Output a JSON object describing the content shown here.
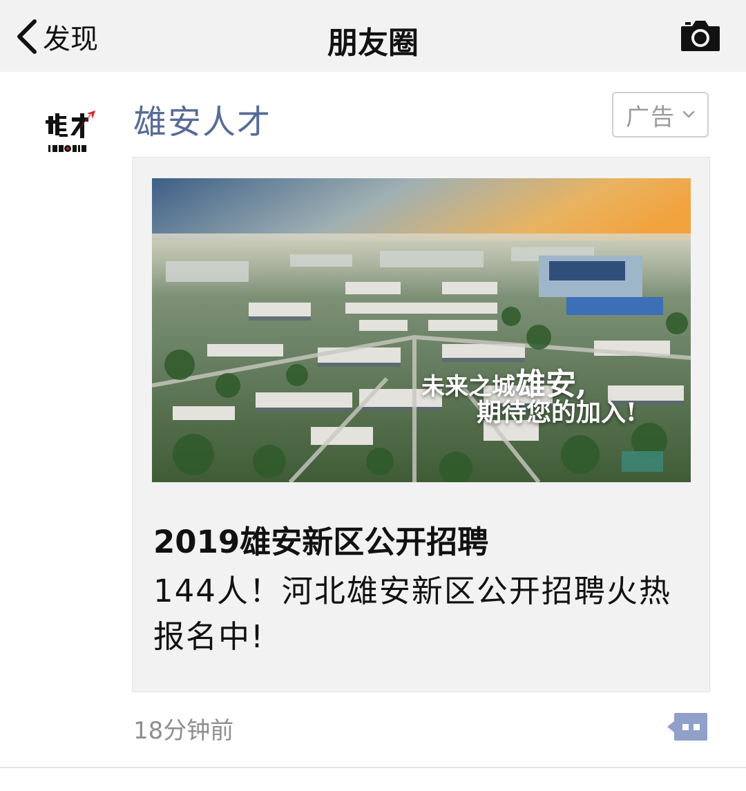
{
  "nav": {
    "back_label": "发现",
    "title": "朋友圈",
    "back_icon": "chevron-left-icon",
    "camera_icon": "camera-icon"
  },
  "post": {
    "author": "雄安人才",
    "avatar": {
      "logo_text": "雄才",
      "logo_subtext": "IGUOPIN",
      "accent_color": "#d9252a"
    },
    "ad_tag": {
      "label": "广告",
      "icon": "chevron-down-icon"
    },
    "card": {
      "image_caption_line1_prefix": "未来之城",
      "image_caption_line1_emphasis": "雄安,",
      "image_caption_line2": "期待您的加入!",
      "headline": "2019雄安新区公开招聘",
      "summary": "144人！河北雄安新区公开招聘火热报名中!"
    },
    "timestamp": "18分钟前",
    "comment_icon": "comment-icon"
  },
  "colors": {
    "nav_background": "#f2f2f2",
    "author_link": "#576b95",
    "comment_button": "#8fa0c9",
    "card_background": "#f2f2f2"
  }
}
